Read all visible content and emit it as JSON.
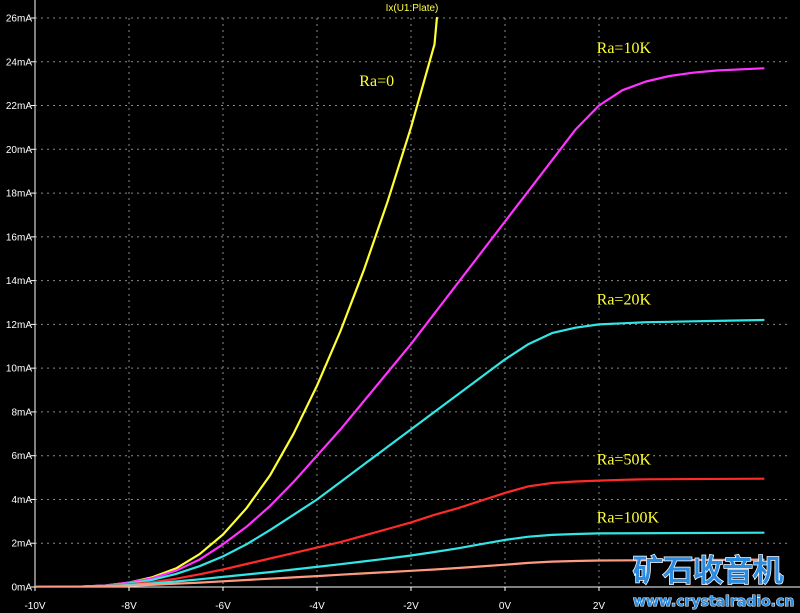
{
  "chart_data": {
    "type": "line",
    "title": "Ix(U1:Plate)",
    "xlim": [
      -10,
      2.8
    ],
    "ylim": [
      0,
      26
    ],
    "x_ticks": [
      {
        "value": -10,
        "label": "-10V"
      },
      {
        "value": -8,
        "label": "-8V"
      },
      {
        "value": -6,
        "label": "-6V"
      },
      {
        "value": -4,
        "label": "-4V"
      },
      {
        "value": -2,
        "label": "-2V"
      },
      {
        "value": 0,
        "label": "0V"
      },
      {
        "value": 2,
        "label": "2V"
      }
    ],
    "y_ticks": [
      {
        "value": 0,
        "label": "0mA"
      },
      {
        "value": 2,
        "label": "2mA"
      },
      {
        "value": 4,
        "label": "4mA"
      },
      {
        "value": 6,
        "label": "6mA"
      },
      {
        "value": 8,
        "label": "8mA"
      },
      {
        "value": 10,
        "label": "10mA"
      },
      {
        "value": 12,
        "label": "12mA"
      },
      {
        "value": 14,
        "label": "14mA"
      },
      {
        "value": 16,
        "label": "16mA"
      },
      {
        "value": 18,
        "label": "18mA"
      },
      {
        "value": 20,
        "label": "20mA"
      },
      {
        "value": 22,
        "label": "22mA"
      },
      {
        "value": 24,
        "label": "24mA"
      },
      {
        "value": 26,
        "label": "26mA"
      }
    ],
    "grid": true,
    "series": [
      {
        "name": "Ra=0",
        "color": "#ffff33",
        "x": [
          -10,
          -9,
          -8.5,
          -8,
          -7.5,
          -7,
          -6.5,
          -6,
          -5.5,
          -5,
          -4.5,
          -4,
          -3.5,
          -3,
          -2.5,
          -2,
          -1.5,
          -1.45
        ],
        "y": [
          0,
          0.02,
          0.07,
          0.2,
          0.45,
          0.85,
          1.5,
          2.4,
          3.6,
          5.1,
          7.0,
          9.2,
          11.7,
          14.5,
          17.6,
          21.0,
          24.8,
          26
        ]
      },
      {
        "name": "Ra=10K",
        "color": "#ff33ff",
        "x": [
          -10,
          -9,
          -8.5,
          -8,
          -7.5,
          -7,
          -6.5,
          -6,
          -5.5,
          -5,
          -4.5,
          -4,
          -3.5,
          -3,
          -2.5,
          -2,
          -1.5,
          -1,
          -0.5,
          0,
          0.5,
          1,
          1.5,
          2,
          2.5,
          3,
          3.5,
          4,
          4.5,
          5.5
        ],
        "y": [
          0,
          0.02,
          0.07,
          0.2,
          0.4,
          0.75,
          1.25,
          1.95,
          2.75,
          3.7,
          4.8,
          6.0,
          7.2,
          8.5,
          9.8,
          11.1,
          12.5,
          13.9,
          15.3,
          16.7,
          18.1,
          19.5,
          20.9,
          22.0,
          22.7,
          23.1,
          23.35,
          23.5,
          23.6,
          23.7
        ]
      },
      {
        "name": "Ra=20K",
        "color": "#33e6e6",
        "x": [
          -10,
          -9,
          -8.5,
          -8,
          -7.5,
          -7,
          -6.5,
          -6,
          -5.5,
          -5,
          -4.5,
          -4,
          -3.5,
          -3,
          -2.5,
          -2,
          -1.5,
          -1,
          -0.5,
          0,
          0.5,
          1,
          1.5,
          2,
          2.5,
          3,
          3.5,
          4,
          4.5,
          5.5
        ],
        "y": [
          0,
          0.02,
          0.06,
          0.16,
          0.33,
          0.6,
          0.95,
          1.4,
          1.95,
          2.6,
          3.3,
          4.0,
          4.8,
          5.6,
          6.4,
          7.2,
          8.0,
          8.8,
          9.6,
          10.4,
          11.1,
          11.6,
          11.85,
          12.0,
          12.05,
          12.1,
          12.12,
          12.14,
          12.16,
          12.2
        ]
      },
      {
        "name": "Ra=50K",
        "color": "#ff2a2a",
        "x": [
          -10,
          -9,
          -8.5,
          -8,
          -7.5,
          -7,
          -6.5,
          -6,
          -5.5,
          -5,
          -4.5,
          -4,
          -3.5,
          -3,
          -2.5,
          -2,
          -1.5,
          -1,
          -0.5,
          0,
          0.5,
          1,
          1.5,
          2,
          2.5,
          3,
          5.5
        ],
        "y": [
          0,
          0.02,
          0.05,
          0.12,
          0.22,
          0.38,
          0.58,
          0.8,
          1.05,
          1.3,
          1.55,
          1.8,
          2.05,
          2.35,
          2.65,
          2.95,
          3.3,
          3.6,
          3.95,
          4.3,
          4.6,
          4.75,
          4.82,
          4.86,
          4.9,
          4.92,
          4.95
        ]
      },
      {
        "name": "Ra=100K",
        "color": "#33e6e6",
        "x": [
          -10,
          -9,
          -8.5,
          -8,
          -7.5,
          -7,
          -6.5,
          -6,
          -5.5,
          -5,
          -4.5,
          -4,
          -3.5,
          -3,
          -2.5,
          -2,
          -1.5,
          -1,
          -0.5,
          0,
          0.5,
          1,
          1.5,
          2,
          5.5
        ],
        "y": [
          0,
          0.02,
          0.04,
          0.09,
          0.16,
          0.25,
          0.35,
          0.46,
          0.57,
          0.68,
          0.8,
          0.92,
          1.04,
          1.17,
          1.3,
          1.44,
          1.6,
          1.77,
          1.96,
          2.15,
          2.3,
          2.38,
          2.42,
          2.45,
          2.48
        ]
      },
      {
        "name": "",
        "color": "#ff9a82",
        "x": [
          -10,
          -9,
          -8.5,
          -8,
          -7.5,
          -7,
          -6.5,
          -6,
          -5.5,
          -5,
          -4.5,
          -4,
          -3.5,
          -3,
          -2.5,
          -2,
          -1.5,
          -1,
          -0.5,
          0,
          0.5,
          1,
          1.5,
          2,
          5.5
        ],
        "y": [
          0,
          0.02,
          0.03,
          0.06,
          0.1,
          0.15,
          0.2,
          0.26,
          0.32,
          0.38,
          0.44,
          0.5,
          0.56,
          0.62,
          0.68,
          0.74,
          0.8,
          0.87,
          0.94,
          1.02,
          1.1,
          1.16,
          1.19,
          1.21,
          1.25
        ]
      }
    ],
    "annotations": [
      {
        "text": "Ra=0",
        "x": -3.1,
        "y": 22.9,
        "color": "#ffff33"
      },
      {
        "text": "Ra=10K",
        "x": 1.95,
        "y": 24.4,
        "color": "#ffff33"
      },
      {
        "text": "Ra=20K",
        "x": 1.95,
        "y": 12.9,
        "color": "#ffff33"
      },
      {
        "text": "Ra=50K",
        "x": 1.95,
        "y": 5.6,
        "color": "#ffff33"
      },
      {
        "text": "Ra=100K",
        "x": 1.95,
        "y": 2.95,
        "color": "#ffff33"
      }
    ]
  },
  "watermark": {
    "title": "矿石收音机",
    "url": "www.crystalradio.cn",
    "color": "#2a8be0"
  }
}
